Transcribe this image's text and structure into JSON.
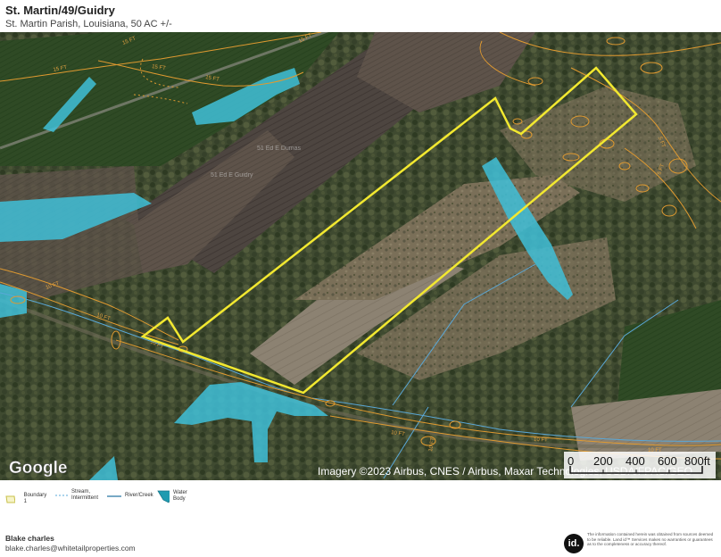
{
  "header": {
    "title": "St. Martin/49/Guidry",
    "subtitle": "St. Martin Parish, Louisiana, 50 AC +/-"
  },
  "map": {
    "google_logo": "Google",
    "attribution": "Imagery ©2023 Airbus, CNES / Airbus, Maxar Technologies, USDA/FPAC/GEO",
    "scale": {
      "labels": [
        "0",
        "200",
        "400",
        "600",
        "800ft"
      ]
    },
    "contour_labels": [
      "15 FT",
      "15 FT",
      "15 FT",
      "15 FT",
      "10 FT",
      "10 FT",
      "10 FT",
      "10 FT",
      "10 FT",
      "10 FT",
      "5 FT",
      "5 FT",
      "10 FT",
      "15 FT"
    ],
    "field_labels": [
      "51 Ed E Dumas",
      "51 Ed E Guidry"
    ],
    "colors": {
      "boundary": "#f2e830",
      "water_body": "#3fc0d8",
      "contour": "#e09a30",
      "stream": "#5aa8d8"
    }
  },
  "legend": {
    "items": [
      {
        "label": "Boundary 1",
        "icon": "boundary-swatch-icon"
      },
      {
        "label": "Stream, Intermittent",
        "icon": "stream-intermittent-icon"
      },
      {
        "label": "River/Creek",
        "icon": "river-creek-icon"
      },
      {
        "label": "Water Body",
        "icon": "water-body-icon"
      }
    ]
  },
  "footer": {
    "agent_name": "Blake charles",
    "agent_email": "blake.charles@whitetailproperties.com",
    "logo_text": "id.",
    "disclaimer": "The information contained herein was obtained from sources deemed to be reliable. Land id™ Services makes no warranties or guarantees as to the completeness or accuracy thereof."
  }
}
